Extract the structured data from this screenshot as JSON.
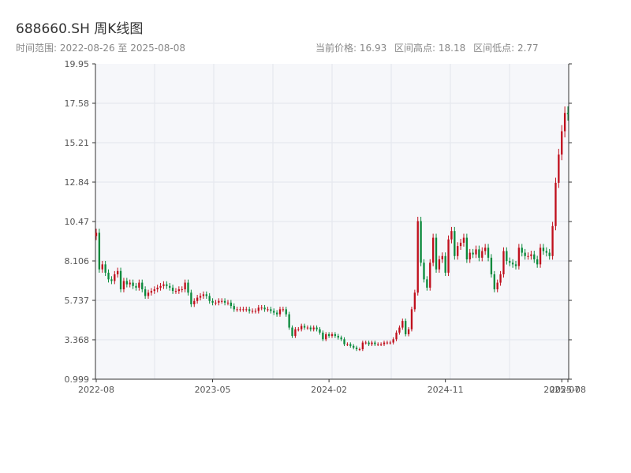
{
  "header": {
    "title": "688660.SH 周K线图",
    "subtitle": "时间范围: 2022-08-26 至 2025-08-08",
    "stat_current": "当前价格: 16.93",
    "stat_high": "区间高点: 18.18",
    "stat_low": "区间低点: 2.77"
  },
  "chart_data": {
    "type": "candlestick",
    "title": "688660.SH 周K线图",
    "y_ticks": [
      "19.95",
      "17.58",
      "15.21",
      "12.84",
      "10.47",
      "8.106",
      "5.737",
      "3.368",
      "0.999"
    ],
    "ylim": [
      0.999,
      19.95
    ],
    "x_ticks": [
      "2022-08",
      "2023-05",
      "2024-02",
      "2024-11",
      "2025-07",
      "2025-08"
    ],
    "x_tick_index": [
      0,
      38,
      76,
      114,
      152,
      154
    ],
    "grid": true,
    "up_color": "#c0101d",
    "down_color": "#0a8a3c",
    "closes": [
      9.8,
      7.6,
      7.9,
      7.4,
      7.0,
      6.9,
      7.3,
      7.5,
      6.4,
      6.9,
      6.7,
      6.8,
      6.6,
      6.5,
      6.8,
      6.4,
      6.0,
      6.2,
      6.3,
      6.4,
      6.5,
      6.6,
      6.7,
      6.6,
      6.5,
      6.3,
      6.3,
      6.4,
      6.4,
      6.8,
      6.2,
      5.5,
      5.7,
      5.9,
      6.0,
      6.1,
      6.0,
      5.7,
      5.6,
      5.6,
      5.7,
      5.7,
      5.6,
      5.6,
      5.4,
      5.2,
      5.2,
      5.2,
      5.2,
      5.2,
      5.1,
      5.1,
      5.1,
      5.3,
      5.3,
      5.2,
      5.2,
      5.1,
      5.0,
      4.9,
      5.2,
      5.2,
      4.9,
      4.1,
      3.6,
      4.0,
      4.0,
      4.2,
      4.1,
      4.1,
      4.0,
      4.1,
      4.0,
      3.8,
      3.4,
      3.7,
      3.6,
      3.7,
      3.6,
      3.5,
      3.4,
      3.1,
      3.1,
      3.0,
      2.9,
      2.8,
      2.8,
      3.2,
      3.2,
      3.1,
      3.2,
      3.1,
      3.1,
      3.1,
      3.2,
      3.2,
      3.2,
      3.4,
      3.8,
      4.1,
      4.5,
      3.7,
      4.0,
      5.2,
      6.2,
      10.5,
      8.0,
      7.0,
      6.5,
      8.0,
      9.5,
      7.6,
      8.2,
      8.4,
      7.4,
      9.4,
      9.9,
      8.4,
      9.0,
      9.2,
      9.5,
      8.2,
      8.6,
      8.5,
      8.8,
      8.3,
      8.7,
      8.9,
      8.3,
      7.3,
      6.4,
      6.8,
      7.3,
      8.7,
      8.1,
      8.0,
      7.9,
      7.8,
      8.9,
      8.6,
      8.4,
      8.4,
      8.5,
      8.2,
      7.9,
      8.9,
      8.7,
      8.6,
      8.4,
      10.2,
      12.8,
      14.5,
      15.9,
      17.0,
      16.93
    ],
    "last_price": 16.93,
    "period_high": 18.18,
    "period_low": 2.77
  }
}
